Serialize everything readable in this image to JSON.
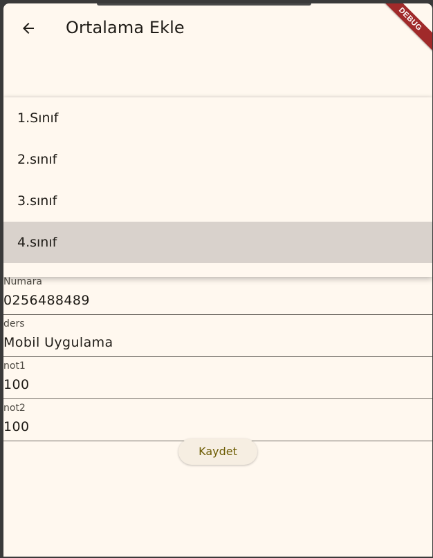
{
  "appbar": {
    "title": "Ortalama Ekle",
    "back_icon": "arrow-left-icon",
    "debug_label": "DEBUG"
  },
  "dropdown": {
    "items": [
      "1.Sınıf",
      "2.sınıf",
      "3.sınıf",
      "4.sınıf"
    ],
    "selected": "4.sınıf"
  },
  "form": {
    "numara": {
      "label": "Numara",
      "value": "0256488489"
    },
    "ders": {
      "label": "ders",
      "value": "Mobil Uygulama"
    },
    "not1": {
      "label": "not1",
      "value": "100"
    },
    "not2": {
      "label": "not2",
      "value": "100"
    }
  },
  "actions": {
    "save_label": "Kaydet"
  },
  "colors": {
    "background": "#fff8ef",
    "selected_item": "#d9d2cc",
    "button_text": "#6b5a00",
    "debug_banner": "#a02a2a"
  }
}
